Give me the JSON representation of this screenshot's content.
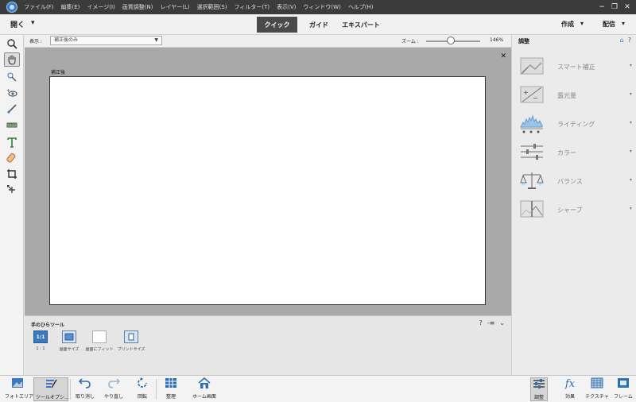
{
  "menubar": {
    "items": [
      "ファイル(F)",
      "編集(E)",
      "イメージ(I)",
      "画質調整(N)",
      "レイヤー(L)",
      "選択範囲(S)",
      "フィルター(T)",
      "表示(V)",
      "ウィンドウ(W)",
      "ヘルプ(H)"
    ],
    "window_controls": [
      "−",
      "❐",
      "✕"
    ]
  },
  "modebar": {
    "open_label": "開く",
    "open_arrow": "▾",
    "tabs": [
      "クイック",
      "ガイド",
      "エキスパート"
    ],
    "active_tab": "クイック",
    "create_label": "作成",
    "share_label": "配信",
    "arrow": "▾"
  },
  "options": {
    "view_label": "表示 :",
    "view_value": "補正後のみ",
    "zoom_label": "ズーム :",
    "zoom_value": "146%",
    "zoom_fraction": 0.45
  },
  "canvas": {
    "title": "補正後",
    "close": "✕"
  },
  "tool_options": {
    "title": "手のひらツール",
    "icons": [
      "?",
      "-≡",
      "⌄"
    ],
    "buttons": [
      {
        "icon_text": "1:1",
        "label": "1 : 1"
      },
      {
        "icon_text": "",
        "label": "画面サイズ"
      },
      {
        "icon_text": "",
        "label": "画面にフィット"
      },
      {
        "icon_text": "",
        "label": "プリントサイズ"
      }
    ]
  },
  "right_panel": {
    "title": "調整",
    "adjustments": [
      {
        "name": "スマート補正",
        "icon": "smart-fix-icon"
      },
      {
        "name": "露光量",
        "icon": "exposure-icon"
      },
      {
        "name": "ライティング",
        "icon": "lighting-icon"
      },
      {
        "name": "カラー",
        "icon": "color-icon"
      },
      {
        "name": "バランス",
        "icon": "balance-icon"
      },
      {
        "name": "シャープ",
        "icon": "sharpen-icon"
      }
    ],
    "chevron": "▾"
  },
  "bottombar": {
    "left": [
      {
        "label": "フォトエリア",
        "icon": "photo-bin-icon"
      },
      {
        "label": "ツールオプシ...",
        "icon": "tool-options-icon"
      },
      {
        "label": "取り消し",
        "icon": "undo-icon"
      },
      {
        "label": "やり直し",
        "icon": "redo-icon"
      },
      {
        "label": "回転",
        "icon": "rotate-icon"
      },
      {
        "label": "整理",
        "icon": "organizer-icon"
      },
      {
        "label": "ホーム画面",
        "icon": "home-icon"
      }
    ],
    "right": [
      {
        "label": "調整",
        "icon": "adjustments-icon"
      },
      {
        "label": "効果",
        "icon": "effects-icon"
      },
      {
        "label": "テクスチャ",
        "icon": "textures-icon"
      },
      {
        "label": "フレーム",
        "icon": "frames-icon"
      }
    ]
  },
  "colors": {
    "accent": "#3a78c0",
    "menubar": "#3b3b3b",
    "active_tab": "#4a4a4a",
    "canvas_bg": "#a9a9a9"
  }
}
